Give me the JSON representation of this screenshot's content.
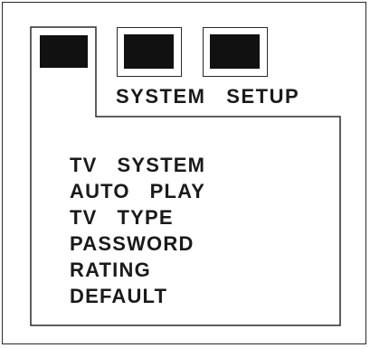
{
  "header": {
    "title": "SYSTEM   SETUP"
  },
  "tabs": [
    {
      "icon": "black-square-icon",
      "active": true
    },
    {
      "icon": "black-square-icon",
      "active": false
    },
    {
      "icon": "black-square-icon",
      "active": false
    }
  ],
  "menu": {
    "items": [
      {
        "label": "TV   SYSTEM"
      },
      {
        "label": "AUTO   PLAY"
      },
      {
        "label": "TV   TYPE"
      },
      {
        "label": "PASSWORD"
      },
      {
        "label": "RATING"
      },
      {
        "label": "DEFAULT"
      }
    ]
  },
  "colors": {
    "line": "#2a2a2a",
    "fill": "#111111",
    "background": "#ffffff"
  }
}
